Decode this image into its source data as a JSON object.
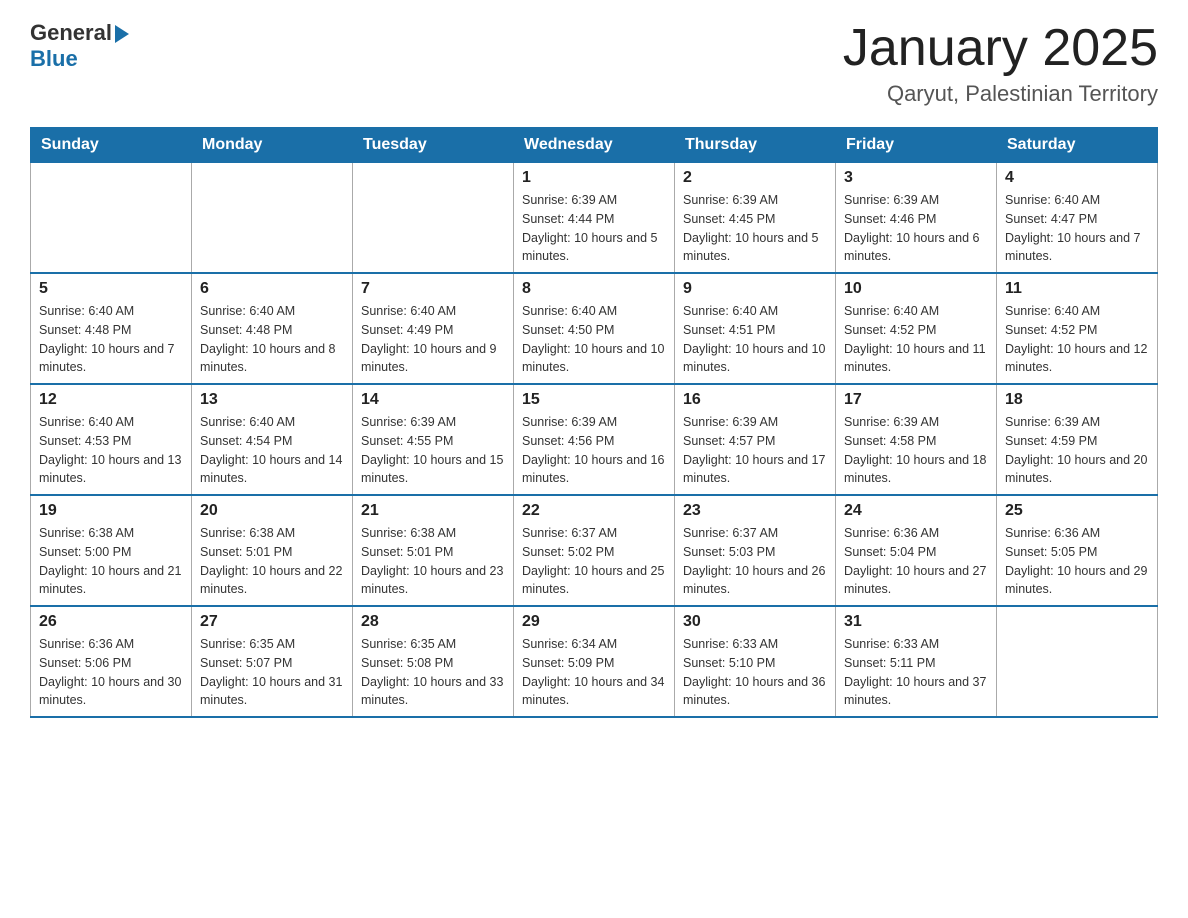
{
  "header": {
    "logo_general": "General",
    "logo_blue": "Blue",
    "title": "January 2025",
    "subtitle": "Qaryut, Palestinian Territory"
  },
  "days_of_week": [
    "Sunday",
    "Monday",
    "Tuesday",
    "Wednesday",
    "Thursday",
    "Friday",
    "Saturday"
  ],
  "weeks": [
    [
      {
        "day": "",
        "info": ""
      },
      {
        "day": "",
        "info": ""
      },
      {
        "day": "",
        "info": ""
      },
      {
        "day": "1",
        "info": "Sunrise: 6:39 AM\nSunset: 4:44 PM\nDaylight: 10 hours and 5 minutes."
      },
      {
        "day": "2",
        "info": "Sunrise: 6:39 AM\nSunset: 4:45 PM\nDaylight: 10 hours and 5 minutes."
      },
      {
        "day": "3",
        "info": "Sunrise: 6:39 AM\nSunset: 4:46 PM\nDaylight: 10 hours and 6 minutes."
      },
      {
        "day": "4",
        "info": "Sunrise: 6:40 AM\nSunset: 4:47 PM\nDaylight: 10 hours and 7 minutes."
      }
    ],
    [
      {
        "day": "5",
        "info": "Sunrise: 6:40 AM\nSunset: 4:48 PM\nDaylight: 10 hours and 7 minutes."
      },
      {
        "day": "6",
        "info": "Sunrise: 6:40 AM\nSunset: 4:48 PM\nDaylight: 10 hours and 8 minutes."
      },
      {
        "day": "7",
        "info": "Sunrise: 6:40 AM\nSunset: 4:49 PM\nDaylight: 10 hours and 9 minutes."
      },
      {
        "day": "8",
        "info": "Sunrise: 6:40 AM\nSunset: 4:50 PM\nDaylight: 10 hours and 10 minutes."
      },
      {
        "day": "9",
        "info": "Sunrise: 6:40 AM\nSunset: 4:51 PM\nDaylight: 10 hours and 10 minutes."
      },
      {
        "day": "10",
        "info": "Sunrise: 6:40 AM\nSunset: 4:52 PM\nDaylight: 10 hours and 11 minutes."
      },
      {
        "day": "11",
        "info": "Sunrise: 6:40 AM\nSunset: 4:52 PM\nDaylight: 10 hours and 12 minutes."
      }
    ],
    [
      {
        "day": "12",
        "info": "Sunrise: 6:40 AM\nSunset: 4:53 PM\nDaylight: 10 hours and 13 minutes."
      },
      {
        "day": "13",
        "info": "Sunrise: 6:40 AM\nSunset: 4:54 PM\nDaylight: 10 hours and 14 minutes."
      },
      {
        "day": "14",
        "info": "Sunrise: 6:39 AM\nSunset: 4:55 PM\nDaylight: 10 hours and 15 minutes."
      },
      {
        "day": "15",
        "info": "Sunrise: 6:39 AM\nSunset: 4:56 PM\nDaylight: 10 hours and 16 minutes."
      },
      {
        "day": "16",
        "info": "Sunrise: 6:39 AM\nSunset: 4:57 PM\nDaylight: 10 hours and 17 minutes."
      },
      {
        "day": "17",
        "info": "Sunrise: 6:39 AM\nSunset: 4:58 PM\nDaylight: 10 hours and 18 minutes."
      },
      {
        "day": "18",
        "info": "Sunrise: 6:39 AM\nSunset: 4:59 PM\nDaylight: 10 hours and 20 minutes."
      }
    ],
    [
      {
        "day": "19",
        "info": "Sunrise: 6:38 AM\nSunset: 5:00 PM\nDaylight: 10 hours and 21 minutes."
      },
      {
        "day": "20",
        "info": "Sunrise: 6:38 AM\nSunset: 5:01 PM\nDaylight: 10 hours and 22 minutes."
      },
      {
        "day": "21",
        "info": "Sunrise: 6:38 AM\nSunset: 5:01 PM\nDaylight: 10 hours and 23 minutes."
      },
      {
        "day": "22",
        "info": "Sunrise: 6:37 AM\nSunset: 5:02 PM\nDaylight: 10 hours and 25 minutes."
      },
      {
        "day": "23",
        "info": "Sunrise: 6:37 AM\nSunset: 5:03 PM\nDaylight: 10 hours and 26 minutes."
      },
      {
        "day": "24",
        "info": "Sunrise: 6:36 AM\nSunset: 5:04 PM\nDaylight: 10 hours and 27 minutes."
      },
      {
        "day": "25",
        "info": "Sunrise: 6:36 AM\nSunset: 5:05 PM\nDaylight: 10 hours and 29 minutes."
      }
    ],
    [
      {
        "day": "26",
        "info": "Sunrise: 6:36 AM\nSunset: 5:06 PM\nDaylight: 10 hours and 30 minutes."
      },
      {
        "day": "27",
        "info": "Sunrise: 6:35 AM\nSunset: 5:07 PM\nDaylight: 10 hours and 31 minutes."
      },
      {
        "day": "28",
        "info": "Sunrise: 6:35 AM\nSunset: 5:08 PM\nDaylight: 10 hours and 33 minutes."
      },
      {
        "day": "29",
        "info": "Sunrise: 6:34 AM\nSunset: 5:09 PM\nDaylight: 10 hours and 34 minutes."
      },
      {
        "day": "30",
        "info": "Sunrise: 6:33 AM\nSunset: 5:10 PM\nDaylight: 10 hours and 36 minutes."
      },
      {
        "day": "31",
        "info": "Sunrise: 6:33 AM\nSunset: 5:11 PM\nDaylight: 10 hours and 37 minutes."
      },
      {
        "day": "",
        "info": ""
      }
    ]
  ]
}
